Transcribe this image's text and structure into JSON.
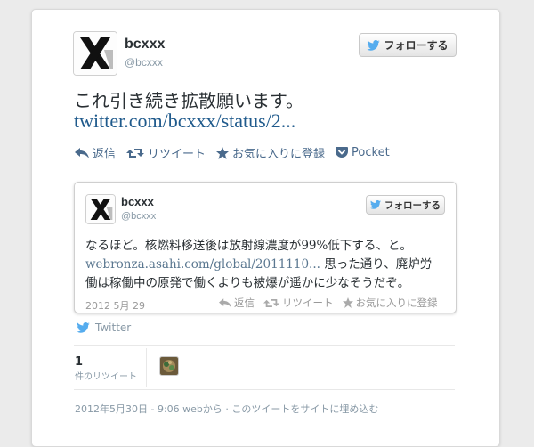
{
  "tweet": {
    "name": "bcxxx",
    "handle": "@bcxxx",
    "follow_label": "フォローする",
    "text": "これ引き続き拡散願います。",
    "link": "twitter.com/bcxxx/status/2...",
    "actions": {
      "reply": "返信",
      "retweet": "リツイート",
      "favorite": "お気に入りに登録",
      "pocket": "Pocket"
    }
  },
  "quoted": {
    "name": "bcxxx",
    "handle": "@bcxxx",
    "follow_label": "フォローする",
    "line1": "なるほど。核燃料移送後は放射線濃度が99%低下する、と。",
    "link": "webronza.asahi.com/global/2011110...",
    "line2_rest": " 思った通り、廃炉労",
    "line3": "働は稼働中の原発で働くよりも被爆が遥かに少なそうだぞ。",
    "date": "2012 5月 29",
    "actions": {
      "reply": "返信",
      "retweet": "リツイート",
      "favorite": "お気に入りに登録"
    }
  },
  "source_label": "Twitter",
  "stats": {
    "retweet_count": "1",
    "retweet_label": "件のリツイート"
  },
  "footer": "2012年5月30日 - 9:06 webから · このツイートをサイトに埋め込む",
  "colors": {
    "twitter_blue": "#55acee",
    "link": "#1f5a8c",
    "action": "#4a6a8c"
  },
  "icons": [
    "x-logo-icon",
    "twitter-bird-icon",
    "reply-icon",
    "retweet-icon",
    "star-icon",
    "pocket-icon"
  ]
}
